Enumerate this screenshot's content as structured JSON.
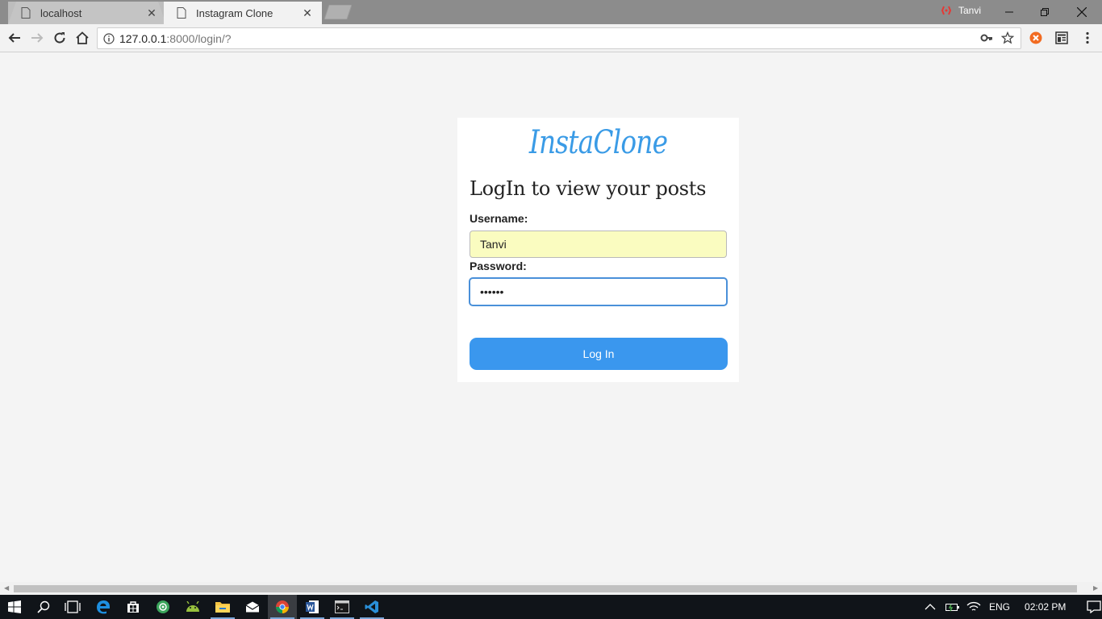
{
  "browser": {
    "tabs": [
      {
        "title": "localhost",
        "active": false
      },
      {
        "title": "Instagram Clone",
        "active": true
      }
    ],
    "profile_name": "Tanvi",
    "url_host": "127.0.0.1",
    "url_rest": ":8000/login/?"
  },
  "page": {
    "brand": "InstaClone",
    "heading": "LogIn to view your posts",
    "username_label": "Username:",
    "username_value": "Tanvi",
    "password_label": "Password:",
    "password_value": "••••••",
    "login_button": "Log In"
  },
  "taskbar": {
    "language": "ENG",
    "time": "02:02 PM"
  },
  "colors": {
    "brand": "#3a9be6",
    "button": "#3a97ee",
    "autofill": "#fafcc0"
  }
}
